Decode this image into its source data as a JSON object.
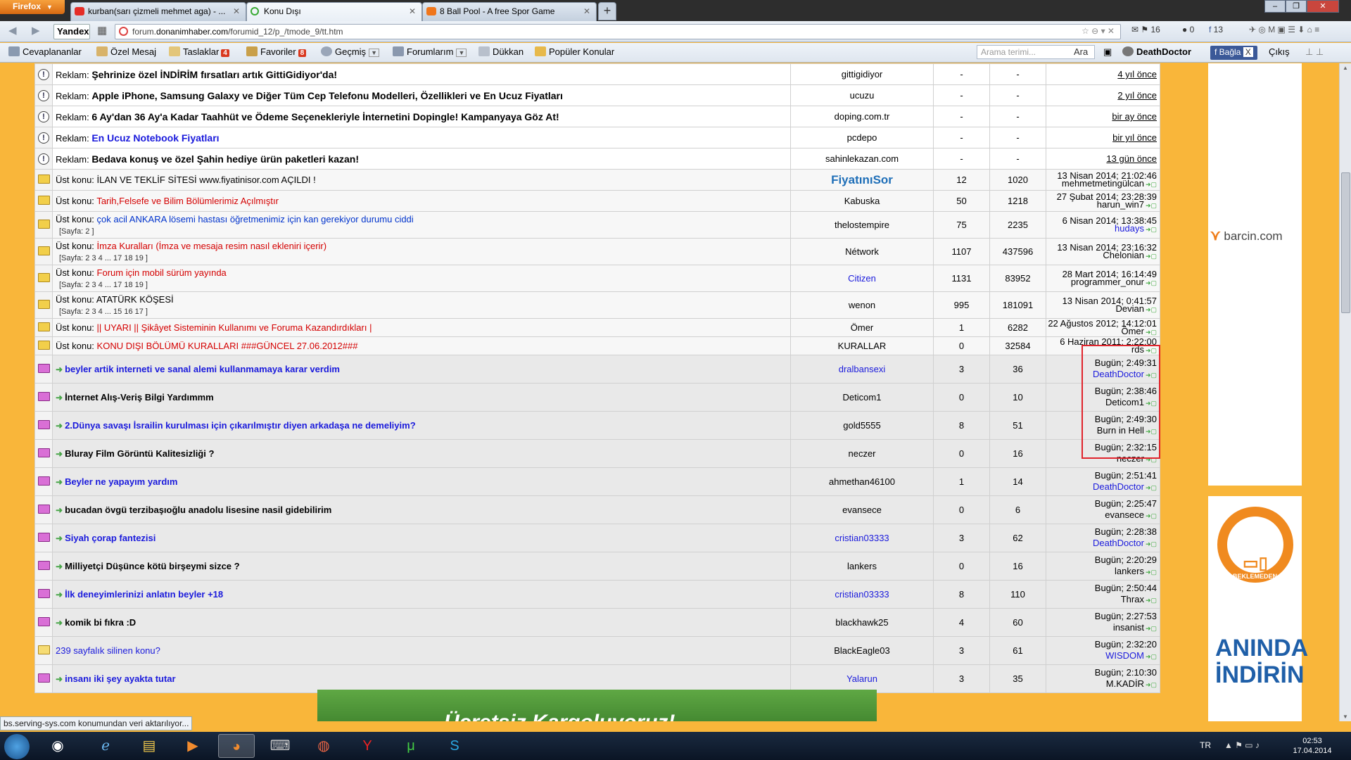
{
  "browser": {
    "app_button": "Firefox",
    "tabs": [
      {
        "label": "kurban(sarı çizmeli mehmet aga) - ...",
        "icon": "youtube-icon",
        "color": "#e52d27"
      },
      {
        "label": "Konu Dışı",
        "icon": "loading-icon",
        "color": "#3aaa35"
      },
      {
        "label": "8 Ball Pool - A free Spor Game",
        "icon": "play-icon",
        "color": "#f0761c"
      }
    ],
    "new_tab": "+",
    "search_engine": "Yandex",
    "url_prefix": "forum.",
    "url_domain": "donanimhaber.com",
    "url_path": "/forumid_12/p_/tmode_9/tt.htm",
    "mail_count": "16",
    "counter2": "0",
    "fb_count": "13"
  },
  "bookmarks": {
    "items": [
      {
        "label": "Cevaplananlar"
      },
      {
        "label": "Özel Mesaj"
      },
      {
        "label": "Taslaklar",
        "badge": "4"
      },
      {
        "label": "Favoriler",
        "badge": "8"
      },
      {
        "label": "Geçmiş"
      },
      {
        "label": "Forumlarım"
      },
      {
        "label": "Dükkan"
      },
      {
        "label": "Popüler Konular"
      }
    ],
    "search_placeholder": "Arama terimi...",
    "search_button": "Ara",
    "username": "DeathDoctor",
    "fb_connect": "Bağla",
    "fb_close": "X",
    "logout": "Çıkış"
  },
  "ads": [
    {
      "label": "Reklam:",
      "title": "Şehrinize özel İNDİRİM fırsatları artık GittiGidiyor'da!",
      "source": "gittigidiyor",
      "replies": "-",
      "views": "-",
      "time": "4 yıl önce"
    },
    {
      "label": "Reklam:",
      "title": "Apple iPhone, Samsung Galaxy ve Diğer Tüm Cep Telefonu Modelleri, Özellikleri ve En Ucuz Fiyatları",
      "source": "ucuzu",
      "replies": "-",
      "views": "-",
      "time": "2 yıl önce"
    },
    {
      "label": "Reklam:",
      "title": "6 Ay'dan 36 Ay'a Kadar Taahhüt ve Ödeme Seçenekleriyle İnternetini Dopingle! Kampanyaya Göz At!",
      "source": "doping.com.tr",
      "replies": "-",
      "views": "-",
      "time": "bir ay önce"
    },
    {
      "label": "Reklam:",
      "title": "En Ucuz Notebook Fiyatları",
      "source": "pcdepo",
      "replies": "-",
      "views": "-",
      "time": "bir yıl önce"
    },
    {
      "label": "Reklam:",
      "title": "Bedava konuş ve özel Şahin hediye ürün paketleri kazan!",
      "source": "sahinlekazan.com",
      "replies": "-",
      "views": "-",
      "time": "13 gün önce"
    }
  ],
  "sticky": [
    {
      "label": "Üst konu:",
      "title": "İLAN VE TEKLİF SİTESİ www.fiyatinisor.com AÇILDI !",
      "pages": "",
      "author": "FiyatınıSor",
      "replies": "12",
      "views": "1020",
      "date": "13 Nisan 2014; 21:02:46",
      "last": "mehmetmetingülcan"
    },
    {
      "label": "Üst konu:",
      "title": "Tarih,Felsefe ve Bilim Bölümlerimiz Açılmıştır",
      "pages": "",
      "author": "Kabuska",
      "replies": "50",
      "views": "1218",
      "date": "27 Şubat 2014; 23:28:39",
      "last": "harun_win7"
    },
    {
      "label": "Üst konu:",
      "title": "çok acil ANKARA lösemi hastası öğretmenimiz için kan gerekiyor durumu ciddi",
      "pages": "[Sayfa: 2 ]",
      "author": "thelostempire",
      "replies": "75",
      "views": "2235",
      "date": "6 Nisan 2014; 13:38:45",
      "last": "hudays"
    },
    {
      "label": "Üst konu:",
      "title": "İmza Kuralları (İmza ve mesaja resim nasıl ekleniri içerir)",
      "pages": "[Sayfa: 2 3 4 ... 17 18 19 ]",
      "author": "Nétwork",
      "replies": "1107",
      "views": "437596",
      "date": "13 Nisan 2014; 23:16:32",
      "last": "Chelonian"
    },
    {
      "label": "Üst konu:",
      "title": "Forum için mobil sürüm yayında",
      "pages": "[Sayfa: 2 3 4 ... 17 18 19 ]",
      "author": "Citizen",
      "replies": "1131",
      "views": "83952",
      "date": "28 Mart 2014; 16:14:49",
      "last": "programmer_onur"
    },
    {
      "label": "Üst konu:",
      "title": "ATATÜRK KÖŞESİ",
      "pages": "[Sayfa: 2 3 4 ... 15 16 17 ]",
      "author": "wenon",
      "replies": "995",
      "views": "181091",
      "date": "13 Nisan 2014; 0:41:57",
      "last": "Devian"
    },
    {
      "label": "Üst konu:",
      "title": "|| UYARI || Şikâyet Sisteminin Kullanımı ve Foruma Kazandırdıkları |",
      "pages": "",
      "author": "Ömer",
      "replies": "1",
      "views": "6282",
      "date": "22 Ağustos 2012; 14:12:01",
      "last": "Ömer"
    },
    {
      "label": "Üst konu:",
      "title": "KONU DIŞI BÖLÜMÜ KURALLARI ###GÜNCEL 27.06.2012###",
      "pages": "",
      "author": "KURALLAR",
      "replies": "0",
      "views": "32584",
      "date": "6 Haziran 2011; 2:22:00",
      "last": "rds"
    }
  ],
  "topics": [
    {
      "title": "beyler artik interneti ve sanal alemi kullanmamaya karar verdim",
      "author": "dralbansexi",
      "replies": "3",
      "views": "36",
      "date": "Bugün; 2:49:31",
      "last": "DeathDoctor"
    },
    {
      "title": "İnternet Alış-Veriş Bilgi Yardımmm",
      "author": "Deticom1",
      "replies": "0",
      "views": "10",
      "date": "Bugün; 2:38:46",
      "last": "Deticom1"
    },
    {
      "title": "2.Dünya savaşı İsrailin kurulması için çıkarılmıştır diyen arkadaşa ne demeliyim?",
      "author": "gold5555",
      "replies": "8",
      "views": "51",
      "date": "Bugün; 2:49:30",
      "last": "Burn in Hell"
    },
    {
      "title": "Bluray Film Görüntü Kalitesizliği ?",
      "author": "neczer",
      "replies": "0",
      "views": "16",
      "date": "Bugün; 2:32:15",
      "last": "neczer"
    },
    {
      "title": "Beyler ne yapayım yardım",
      "author": "ahmethan46100",
      "replies": "1",
      "views": "14",
      "date": "Bugün; 2:51:41",
      "last": "DeathDoctor"
    },
    {
      "title": "bucadan övgü terzibaşıoğlu anadolu lisesine nasil gidebilirim",
      "author": "evansece",
      "replies": "0",
      "views": "6",
      "date": "Bugün; 2:25:47",
      "last": "evansece"
    },
    {
      "title": "Siyah çorap fantezisi",
      "author": "cristian03333",
      "replies": "3",
      "views": "62",
      "date": "Bugün; 2:28:38",
      "last": "DeathDoctor"
    },
    {
      "title": "Milliyetçi Düşünce kötü birşeymi sizce ?",
      "author": "lankers",
      "replies": "0",
      "views": "16",
      "date": "Bugün; 2:20:29",
      "last": "lankers"
    },
    {
      "title": "İlk deneyimlerinizi anlatın beyler +18",
      "author": "cristian03333",
      "replies": "8",
      "views": "110",
      "date": "Bugün; 2:50:44",
      "last": "Thrax"
    },
    {
      "title": "komik bi fıkra :D",
      "author": "blackhawk25",
      "replies": "4",
      "views": "60",
      "date": "Bugün; 2:27:53",
      "last": "insanist"
    },
    {
      "title": "239 sayfalık silinen konu?",
      "author": "BlackEagle03",
      "replies": "3",
      "views": "61",
      "date": "Bugün; 2:32:20",
      "last": "WISDOM"
    },
    {
      "title": "insanı iki şey ayakta tutar",
      "author": "Yalarun",
      "replies": "3",
      "views": "35",
      "date": "Bugün; 2:10:30",
      "last": "M.KADİR"
    }
  ],
  "side_ads": {
    "barcin_brand": "barcin.com",
    "bekle_text": "BEKLEMEDEN",
    "aninda": "ANINDA",
    "indirin": "İNDİRİN",
    "bottom_banner": "Ücretsiz Kargoluyoruz!"
  },
  "status_text": "bs.serving-sys.com konumundan veri aktarılıyor...",
  "taskbar": {
    "lang": "TR",
    "time": "02:53",
    "date": "17.04.2014"
  }
}
